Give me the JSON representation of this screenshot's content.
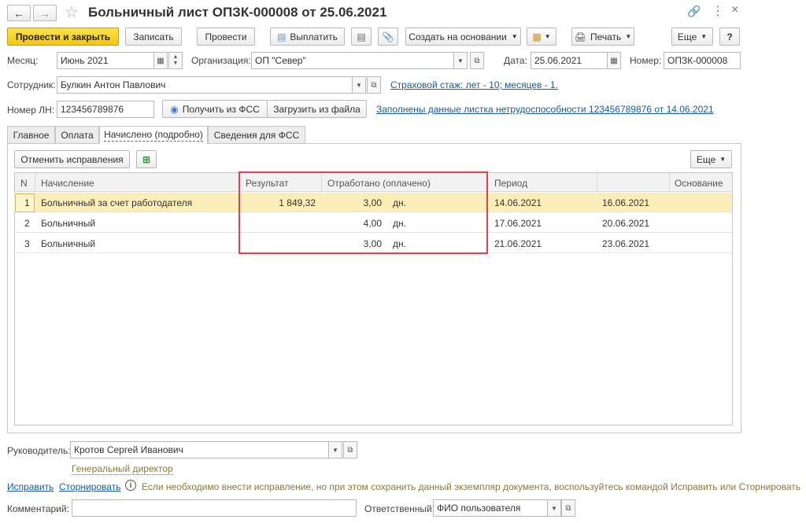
{
  "window": {
    "title": "Больничный лист ОПЗК-000008 от 25.06.2021"
  },
  "toolbar": {
    "post_close": "Провести и закрыть",
    "save": "Записать",
    "post": "Провести",
    "pay": "Выплатить",
    "create_based": "Создать на основании",
    "print": "Печать",
    "more": "Еще",
    "help": "?"
  },
  "header": {
    "month_label": "Месяц:",
    "month_value": "Июнь 2021",
    "org_label": "Организация:",
    "org_value": "ОП \"Север\"",
    "date_label": "Дата:",
    "date_value": "25.06.2021",
    "number_label": "Номер:",
    "number_value": "ОПЗК-000008",
    "employee_label": "Сотрудник:",
    "employee_value": "Булкин Антон Павлович",
    "insurance_link": "Страховой стаж: лет - 10; месяцев - 1.",
    "ln_label": "Номер ЛН:",
    "ln_value": "123456789876",
    "get_fss": "Получить из ФСС",
    "load_file": "Загрузить из файла",
    "filled_link": "Заполнены данные листка нетрудоспособности 123456789876 от 14.06.2021"
  },
  "tabs": [
    {
      "label": "Главное"
    },
    {
      "label": "Оплата"
    },
    {
      "label": "Начислено (подробно)"
    },
    {
      "label": "Сведения для ФСС"
    }
  ],
  "grid_toolbar": {
    "cancel_fix": "Отменить исправления",
    "more": "Еще"
  },
  "grid": {
    "headers": {
      "n": "N",
      "accrual": "Начисление",
      "result": "Результат",
      "worked": "Отработано (оплачено)",
      "period": "Период",
      "basis": "Основание"
    },
    "rows": [
      {
        "n": "1",
        "accrual": "Больничный за счет работодателя",
        "result": "1 849,32",
        "worked": "3,00",
        "unit": "дн.",
        "from": "14.06.2021",
        "to": "16.06.2021",
        "basis": ""
      },
      {
        "n": "2",
        "accrual": "Больничный",
        "result": "",
        "worked": "4,00",
        "unit": "дн.",
        "from": "17.06.2021",
        "to": "20.06.2021",
        "basis": ""
      },
      {
        "n": "3",
        "accrual": "Больничный",
        "result": "",
        "worked": "3,00",
        "unit": "дн.",
        "from": "21.06.2021",
        "to": "23.06.2021",
        "basis": ""
      }
    ]
  },
  "footer": {
    "manager_label": "Руководитель:",
    "manager_value": "Кротов Сергей Иванович",
    "manager_position": "Генеральный директор",
    "fix_link": "Исправить",
    "reverse_link": "Сторнировать",
    "info_text": "Если необходимо внести исправление, но при этом сохранить данный экземпляр документа, воспользуйтесь командой Исправить или Сторнировать",
    "comment_label": "Комментарий:",
    "comment_value": "",
    "responsible_label": "Ответственный:",
    "responsible_value": "ФИО пользователя"
  },
  "colors": {
    "highlight_box": "#e0434f",
    "link": "#1a5aa3",
    "selected_row": "#fbeeb8",
    "primary_button": "#f4c60e"
  }
}
